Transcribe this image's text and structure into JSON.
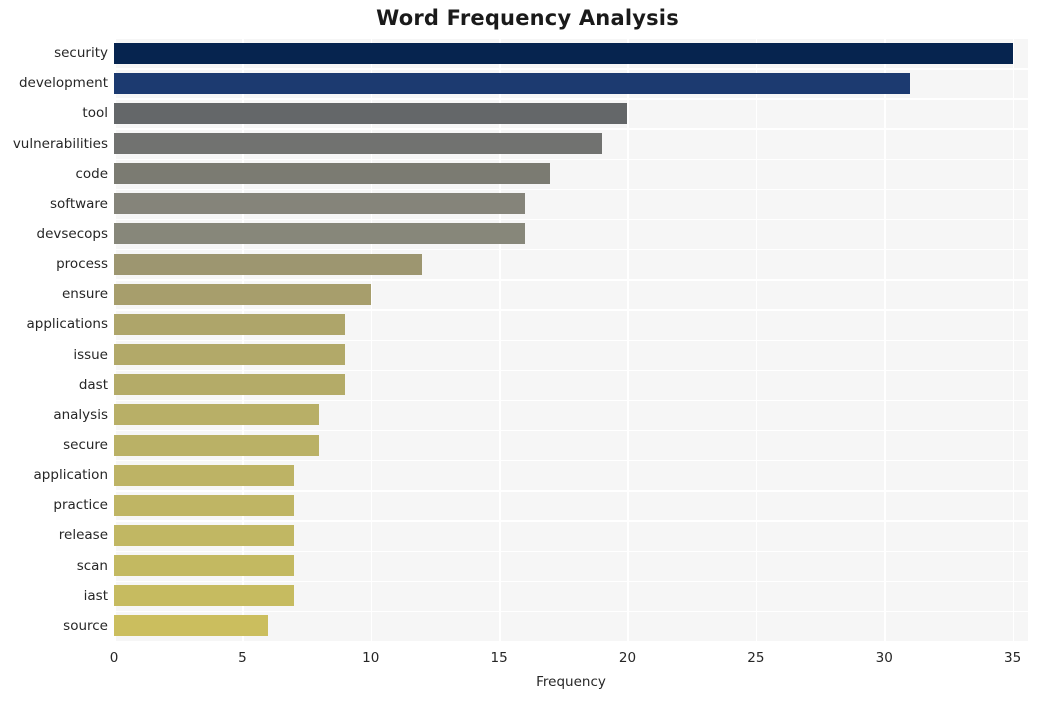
{
  "chart_data": {
    "type": "bar",
    "orientation": "horizontal",
    "title": "Word Frequency Analysis",
    "xlabel": "Frequency",
    "ylabel": "",
    "xlim": [
      0,
      35.6
    ],
    "ylim": [
      0,
      20
    ],
    "grid": true,
    "legend": null,
    "xticks": [
      "0",
      "5",
      "10",
      "15",
      "20",
      "25",
      "30",
      "35"
    ],
    "xtick_values": [
      0,
      5,
      10,
      15,
      20,
      25,
      30,
      35
    ],
    "categories": [
      "security",
      "development",
      "tool",
      "vulnerabilities",
      "code",
      "software",
      "devsecops",
      "process",
      "ensure",
      "applications",
      "issue",
      "dast",
      "analysis",
      "secure",
      "application",
      "practice",
      "release",
      "scan",
      "iast",
      "source"
    ],
    "values": [
      35,
      31,
      20,
      19,
      17,
      16,
      16,
      12,
      10,
      9,
      9,
      9,
      8,
      8,
      7,
      7,
      7,
      7,
      7,
      6
    ],
    "bar_colors": [
      "#06244f",
      "#1c3a70",
      "#646769",
      "#717270",
      "#7b7b72",
      "#85847a",
      "#87877a",
      "#9d9670",
      "#a79e6c",
      "#aea56a",
      "#b2a969",
      "#b4ab68",
      "#b8af67",
      "#bab166",
      "#bdb365",
      "#bfb564",
      "#c1b763",
      "#c3b961",
      "#c6bb60",
      "#cbbe5e"
    ],
    "plot_background": "#f6f6f6",
    "grid_color": "#ffffff",
    "figure_background": "#ffffff"
  }
}
